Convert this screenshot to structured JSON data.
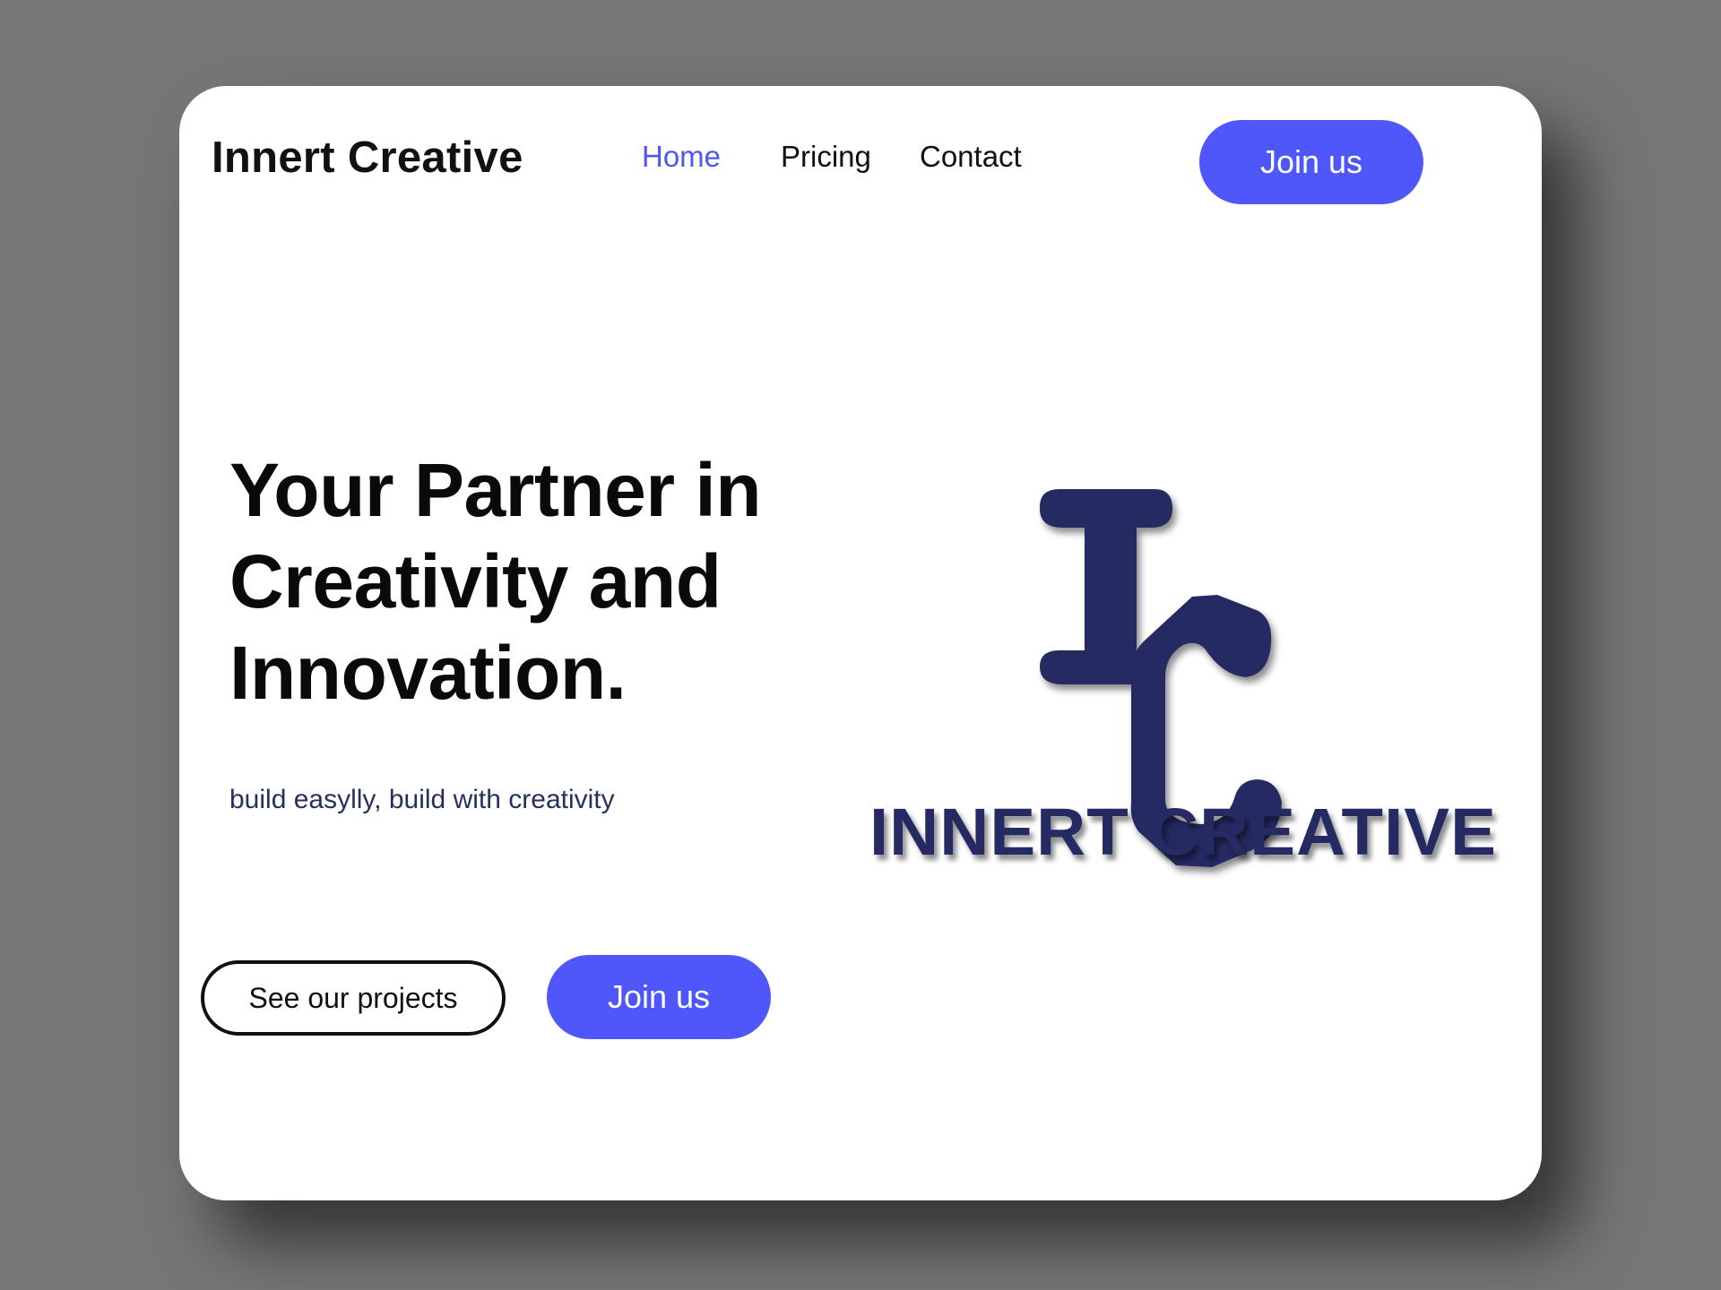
{
  "header": {
    "brand": "Innert Creative",
    "nav": [
      {
        "label": "Home",
        "active": true
      },
      {
        "label": "Pricing",
        "active": false
      },
      {
        "label": "Contact",
        "active": false
      }
    ],
    "cta_label": "Join us"
  },
  "hero": {
    "title_lines": [
      "Your Partner in",
      "Creativity and",
      "Innovation."
    ],
    "subtitle": "build easylly, build with creativity",
    "secondary_button": "See our projects",
    "primary_button": "Join us"
  },
  "logo": {
    "monogram": "IC",
    "wordmark": "INNERT CREATIVE"
  },
  "colors": {
    "accent": "#4f57fb",
    "nav_active": "#4f57f2",
    "logo": "#252a63",
    "backdrop": "#767676"
  }
}
